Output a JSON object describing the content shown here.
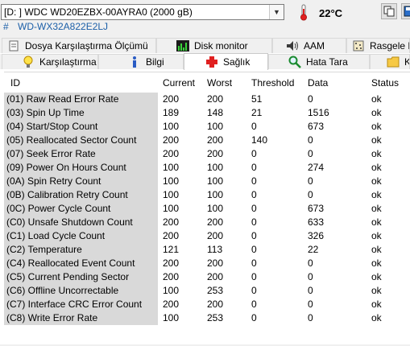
{
  "drive": {
    "selected": "[D: ] WDC WD20EZBX-00AYRA0 (2000 gB)",
    "temperature": "22°C",
    "serial_hash": "#",
    "serial": "WD-WX32A822E2LJ"
  },
  "tabs_row1": [
    {
      "label": "Dosya Karşılaştırma Ölçümü",
      "icon": "file-compare-icon"
    },
    {
      "label": "Disk monitor",
      "icon": "chart-icon"
    },
    {
      "label": "AAM",
      "icon": "speaker-icon"
    },
    {
      "label": "Rasgele E",
      "icon": "random-icon"
    }
  ],
  "tabs_row2": [
    {
      "label": "Karşılaştırma",
      "icon": "lightbulb-icon"
    },
    {
      "label": "Bilgi",
      "icon": "info-icon"
    },
    {
      "label": "Sağlık",
      "icon": "health-cross-icon",
      "active": true
    },
    {
      "label": "Hata Tara",
      "icon": "magnifier-icon"
    },
    {
      "label": "K",
      "icon": "folder-icon"
    }
  ],
  "columns": [
    "ID",
    "Current",
    "Worst",
    "Threshold",
    "Data",
    "Status"
  ],
  "rows": [
    {
      "id": "(01) Raw Read Error Rate",
      "current": "200",
      "worst": "200",
      "threshold": "51",
      "data": "0",
      "status": "ok"
    },
    {
      "id": "(03) Spin Up Time",
      "current": "189",
      "worst": "148",
      "threshold": "21",
      "data": "1516",
      "status": "ok"
    },
    {
      "id": "(04) Start/Stop Count",
      "current": "100",
      "worst": "100",
      "threshold": "0",
      "data": "673",
      "status": "ok"
    },
    {
      "id": "(05) Reallocated Sector Count",
      "current": "200",
      "worst": "200",
      "threshold": "140",
      "data": "0",
      "status": "ok"
    },
    {
      "id": "(07) Seek Error Rate",
      "current": "200",
      "worst": "200",
      "threshold": "0",
      "data": "0",
      "status": "ok"
    },
    {
      "id": "(09) Power On Hours Count",
      "current": "100",
      "worst": "100",
      "threshold": "0",
      "data": "274",
      "status": "ok"
    },
    {
      "id": "(0A) Spin Retry Count",
      "current": "100",
      "worst": "100",
      "threshold": "0",
      "data": "0",
      "status": "ok"
    },
    {
      "id": "(0B) Calibration Retry Count",
      "current": "100",
      "worst": "100",
      "threshold": "0",
      "data": "0",
      "status": "ok"
    },
    {
      "id": "(0C) Power Cycle Count",
      "current": "100",
      "worst": "100",
      "threshold": "0",
      "data": "673",
      "status": "ok"
    },
    {
      "id": "(C0) Unsafe Shutdown Count",
      "current": "200",
      "worst": "200",
      "threshold": "0",
      "data": "633",
      "status": "ok"
    },
    {
      "id": "(C1) Load Cycle Count",
      "current": "200",
      "worst": "200",
      "threshold": "0",
      "data": "326",
      "status": "ok"
    },
    {
      "id": "(C2) Temperature",
      "current": "121",
      "worst": "113",
      "threshold": "0",
      "data": "22",
      "status": "ok"
    },
    {
      "id": "(C4) Reallocated Event Count",
      "current": "200",
      "worst": "200",
      "threshold": "0",
      "data": "0",
      "status": "ok"
    },
    {
      "id": "(C5) Current Pending Sector",
      "current": "200",
      "worst": "200",
      "threshold": "0",
      "data": "0",
      "status": "ok"
    },
    {
      "id": "(C6) Offline Uncorrectable",
      "current": "100",
      "worst": "253",
      "threshold": "0",
      "data": "0",
      "status": "ok"
    },
    {
      "id": "(C7) Interface CRC Error Count",
      "current": "200",
      "worst": "200",
      "threshold": "0",
      "data": "0",
      "status": "ok"
    },
    {
      "id": "(C8) Write Error Rate",
      "current": "100",
      "worst": "253",
      "threshold": "0",
      "data": "0",
      "status": "ok"
    }
  ],
  "colors": {
    "id_column_bg": "#d9d9d9",
    "serial_text": "#1c5fa8",
    "window_bg": "#f0f0f0",
    "health_icon": "#e02020"
  }
}
